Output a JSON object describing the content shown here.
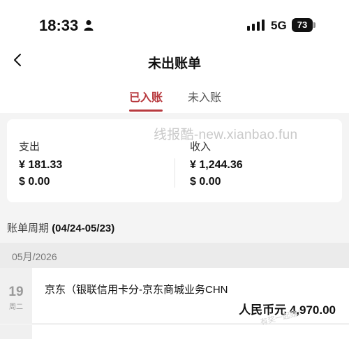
{
  "status_bar": {
    "time": "18:33",
    "network": "5G",
    "battery": "73"
  },
  "header": {
    "title": "未出账单",
    "tabs": [
      {
        "label": "已入账",
        "active": true
      },
      {
        "label": "未入账",
        "active": false
      }
    ]
  },
  "watermark": "线报酷-new.xianbao.fun",
  "summary": {
    "expense": {
      "label": "支出",
      "cny": "¥ 181.33",
      "usd": "$ 0.00"
    },
    "income": {
      "label": "收入",
      "cny": "¥ 1,244.36",
      "usd": "$ 0.00"
    }
  },
  "cycle": {
    "label": "账单周期",
    "range": "(04/24-05/23)"
  },
  "month": "05月/2026",
  "transactions": [
    {
      "day": "19",
      "weekday": "周二",
      "merchant": "京东（银联信用卡分-京东商城业务CHN",
      "amount": "人民币元 4,970.00"
    }
  ],
  "corner_watermark": "有奖一起赚！",
  "colors": {
    "accent": "#b83a3f",
    "background": "#f4f4f4",
    "card": "#ffffff"
  },
  "icons": [
    "person-icon",
    "signal-icon",
    "battery-icon",
    "back-icon"
  ]
}
